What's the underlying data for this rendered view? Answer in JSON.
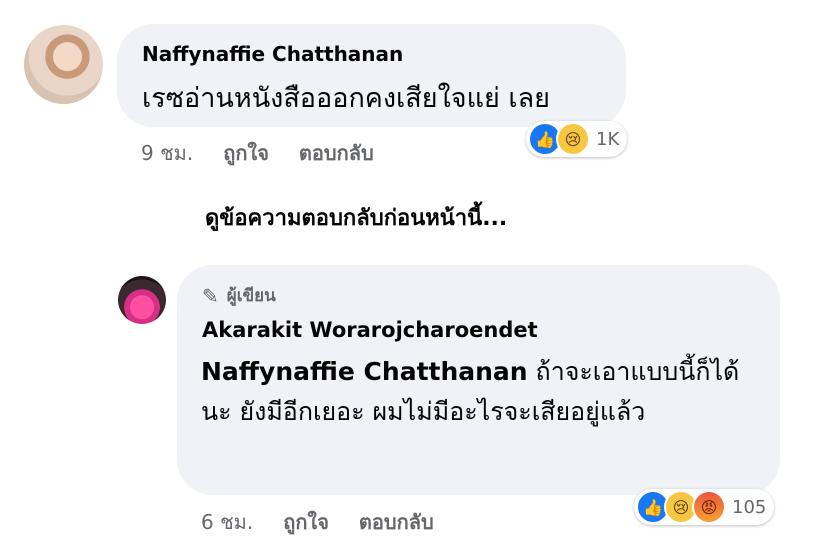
{
  "comment1": {
    "author": "Naffynaffie Chatthanan",
    "text": "เรซอ่านหนังสือออกคงเสียใจแย่ เลย",
    "time": "9 ชม.",
    "like_label": "ถูกใจ",
    "reply_label": "ตอบกลับ",
    "reactions": [
      "like",
      "sad"
    ],
    "reaction_count": "1K"
  },
  "view_previous_replies": "ดูข้อความตอบกลับก่อนหน้านี้...",
  "reply": {
    "badge": "ผู้เขียน",
    "badge_icon": "pen-icon",
    "author": "Akarakit Worarojcharoendet",
    "mention": "Naffynaffie Chatthanan",
    "text": " ถ้าจะเอาแบบนี้ก็ได้นะ ยังมีอีกเยอะ ผมไม่มีอะไรจะเสียอยู่แล้ว",
    "time": "6 ชม.",
    "like_label": "ถูกใจ",
    "reply_label": "ตอบกลับ",
    "reactions": [
      "like",
      "sad",
      "angry"
    ],
    "reaction_count": "105"
  },
  "colors": {
    "bubble_bg": "#f0f2f5",
    "secondary_text": "#65676b",
    "like_blue": "#1877f2"
  }
}
